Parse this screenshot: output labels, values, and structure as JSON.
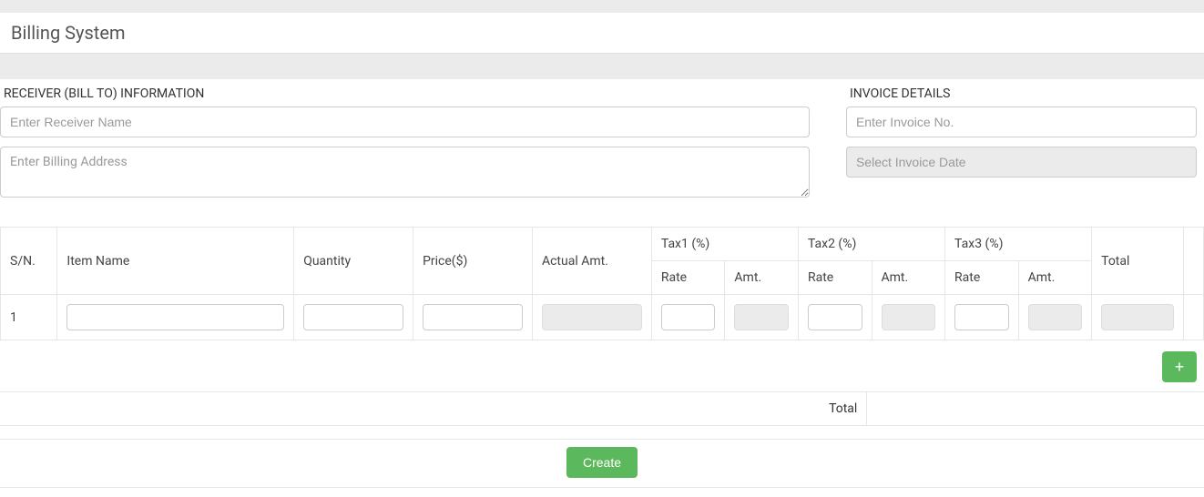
{
  "header": {
    "title": "Billing System"
  },
  "receiver": {
    "section_label": "RECEIVER (BILL TO) INFORMATION",
    "name_placeholder": "Enter Receiver Name",
    "address_placeholder": "Enter Billing Address"
  },
  "invoice": {
    "section_label": "INVOICE DETAILS",
    "number_placeholder": "Enter Invoice No.",
    "date_placeholder": "Select Invoice Date"
  },
  "table": {
    "headers": {
      "sn": "S/N.",
      "item_name": "Item Name",
      "quantity": "Quantity",
      "price": "Price($)",
      "actual_amt": "Actual Amt.",
      "tax1": "Tax1 (%)",
      "tax2": "Tax2 (%)",
      "tax3": "Tax3 (%)",
      "total": "Total",
      "rate": "Rate",
      "amt": "Amt."
    },
    "rows": [
      {
        "sn": "1",
        "item_name": "",
        "quantity": "",
        "price": "",
        "actual_amt": "",
        "tax1_rate": "",
        "tax1_amt": "",
        "tax2_rate": "",
        "tax2_amt": "",
        "tax3_rate": "",
        "tax3_amt": "",
        "total": ""
      }
    ]
  },
  "totals": {
    "label": "Total",
    "value": ""
  },
  "buttons": {
    "add_row": "+",
    "create": "Create"
  }
}
